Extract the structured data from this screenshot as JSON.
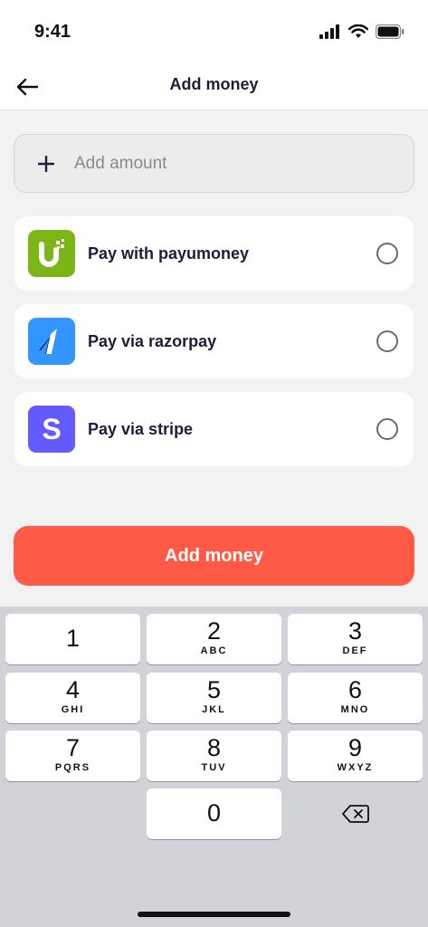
{
  "status_bar": {
    "time": "9:41"
  },
  "header": {
    "title": "Add money",
    "back_icon": "arrow-left-icon"
  },
  "amount": {
    "placeholder": "Add amount",
    "value": "",
    "icon": "plus-icon"
  },
  "payment_options": [
    {
      "label": "Pay with payumoney",
      "logo": "payumoney-logo-icon",
      "logo_color": "#7cb518",
      "selected": false
    },
    {
      "label": "Pay via razorpay",
      "logo": "razorpay-logo-icon",
      "logo_color": "#3395ff",
      "selected": false
    },
    {
      "label": "Pay via stripe",
      "logo": "stripe-logo-icon",
      "logo_color": "#635bff",
      "logo_text": "S",
      "selected": false
    }
  ],
  "primary_button": {
    "label": "Add money",
    "color": "#ff5a45"
  },
  "keyboard": {
    "keys": [
      {
        "digit": "1",
        "letters": ""
      },
      {
        "digit": "2",
        "letters": "ABC"
      },
      {
        "digit": "3",
        "letters": "DEF"
      },
      {
        "digit": "4",
        "letters": "GHI"
      },
      {
        "digit": "5",
        "letters": "JKL"
      },
      {
        "digit": "6",
        "letters": "MNO"
      },
      {
        "digit": "7",
        "letters": "PQRS"
      },
      {
        "digit": "8",
        "letters": "TUV"
      },
      {
        "digit": "9",
        "letters": "WXYZ"
      },
      {
        "digit": "0",
        "letters": ""
      }
    ],
    "delete_icon": "backspace-icon"
  }
}
